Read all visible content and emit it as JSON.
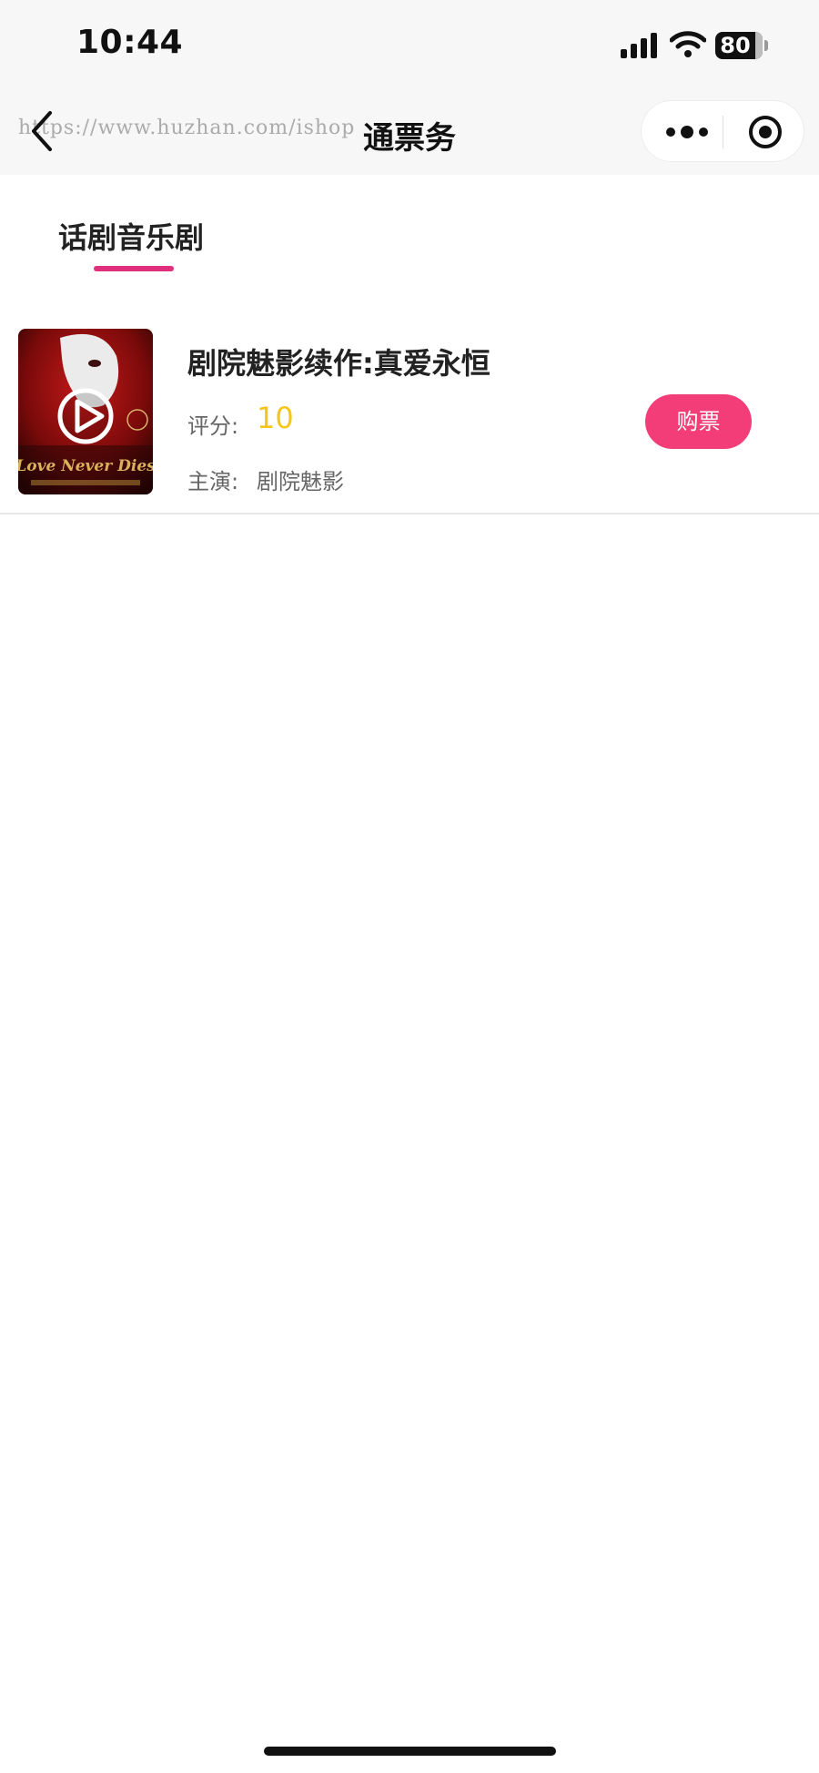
{
  "status_bar": {
    "time": "10:44",
    "battery": "80",
    "icons": [
      "signal-icon",
      "wifi-icon",
      "battery-icon"
    ]
  },
  "nav": {
    "title": "通票务",
    "watermark": "https://www.huzhan.com/ishop",
    "icons": [
      "back-arrow-icon",
      "more-dots-icon",
      "target-icon"
    ]
  },
  "tabs": [
    {
      "label": "话剧音乐剧",
      "active": true
    }
  ],
  "shows": [
    {
      "title": "剧院魅影续作:真爱永恒",
      "rating_label": "评分:",
      "rating": "10",
      "cast_label": "主演:",
      "cast": "剧院魅影",
      "buy_label": "购票",
      "poster_text": "Love Never Dies",
      "poster_icon": "play-icon"
    }
  ],
  "colors": {
    "accent": "#f33d79",
    "tab_underline": "#e02f7c",
    "rating": "#f5c518",
    "nav_bg": "#f7f7f7"
  }
}
